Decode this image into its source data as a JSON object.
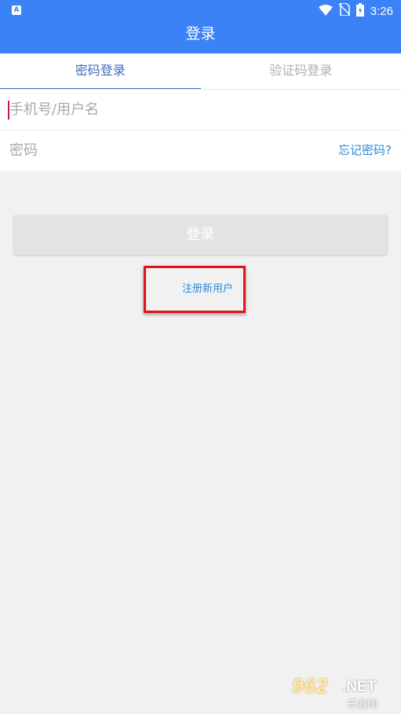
{
  "status_bar": {
    "app_badge": "A",
    "time": "3:26",
    "icons": [
      "wifi-icon",
      "no-sim-icon",
      "battery-icon"
    ]
  },
  "app_bar": {
    "title": "登录"
  },
  "tabs": [
    {
      "label": "密码登录",
      "active": true
    },
    {
      "label": "验证码登录",
      "active": false
    }
  ],
  "form": {
    "username_placeholder": "手机号/用户名",
    "password_placeholder": "密码",
    "forgot_password": "忘记密码?"
  },
  "login_button": "登录",
  "register_link": "注册新用户",
  "watermark": {
    "brand": "962",
    "suffix": ".NET",
    "subtitle": "乐游网"
  },
  "colors": {
    "primary": "#3b82f6",
    "tab_active": "#3b6fc0",
    "link": "#2d8ad8",
    "highlight_box": "#e0121b"
  }
}
